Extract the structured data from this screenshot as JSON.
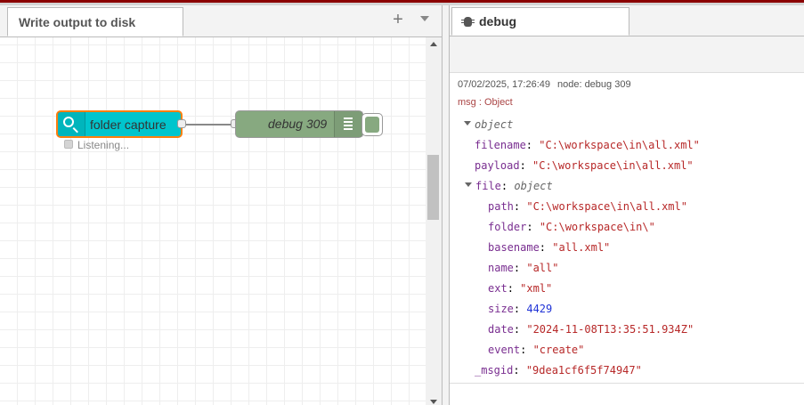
{
  "workspace": {
    "tab_label": "Write output to disk",
    "add_tab_symbol": "+"
  },
  "flow": {
    "capture_node": {
      "label": "folder capture",
      "status": "Listening...",
      "color": "#00c5cd",
      "selected_border": "#ff7f0e",
      "icon": "search-icon"
    },
    "debug_node": {
      "label": "debug 309",
      "color": "#87a980",
      "icon": "list-icon"
    }
  },
  "sidebar": {
    "tab_label": "debug",
    "tab_icon": "bug-icon",
    "message": {
      "timestamp": "07/02/2025, 17:26:49",
      "node": "node: debug 309",
      "topic": "msg : Object",
      "root_type": "object",
      "filename": {
        "key": "filename",
        "value": "\"C:\\workspace\\in\\all.xml\""
      },
      "payload": {
        "key": "payload",
        "value": "\"C:\\workspace\\in\\all.xml\""
      },
      "file": {
        "key": "file",
        "type": "object",
        "path": {
          "key": "path",
          "value": "\"C:\\workspace\\in\\all.xml\""
        },
        "folder": {
          "key": "folder",
          "value": "\"C:\\workspace\\in\\\""
        },
        "basename": {
          "key": "basename",
          "value": "\"all.xml\""
        },
        "name": {
          "key": "name",
          "value": "\"all\""
        },
        "ext": {
          "key": "ext",
          "value": "\"xml\""
        },
        "size": {
          "key": "size",
          "value": "4429"
        },
        "date": {
          "key": "date",
          "value": "\"2024-11-08T13:35:51.934Z\""
        },
        "event": {
          "key": "event",
          "value": "\"create\""
        }
      },
      "msgid": {
        "key": "_msgid",
        "value": "\"9dea1cf6f5f74947\""
      }
    }
  },
  "colors": {
    "key": "#792e90",
    "string": "#b72828",
    "number": "#2033d6"
  }
}
